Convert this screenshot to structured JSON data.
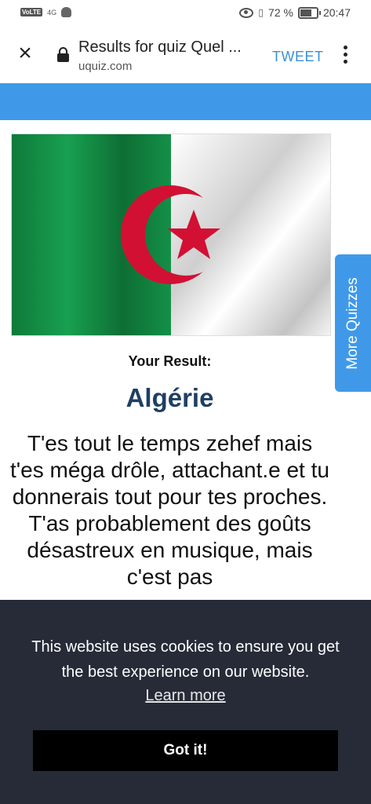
{
  "status_bar": {
    "network_badge": "VoLTE",
    "signal_text": "4G",
    "battery_percent": "72 %",
    "time": "20:47"
  },
  "browser": {
    "title": "Results for quiz Quel ...",
    "url": "uquiz.com",
    "tweet_label": "TWEET"
  },
  "content": {
    "your_result_label": "Your Result:",
    "result_title": "Algérie",
    "description": "T'es tout le temps zehef mais t'es méga drôle, attachant.e et tu donnerais tout pour tes proches. T'as probablement des goûts désastreux en musique, mais c'est pas",
    "more_quizzes_label": "More Quizzes",
    "flag_colors": {
      "green": "#14904a",
      "white": "#f2f2f2",
      "red": "#d21033"
    }
  },
  "cookie_banner": {
    "message": "This website uses cookies to ensure you get the best experience on our website.",
    "learn_more_label": "Learn more",
    "accept_label": "Got it!"
  },
  "icons": [
    "close-icon",
    "lock-icon",
    "more-options-icon",
    "eye-icon",
    "vibrate-icon",
    "battery-icon"
  ]
}
